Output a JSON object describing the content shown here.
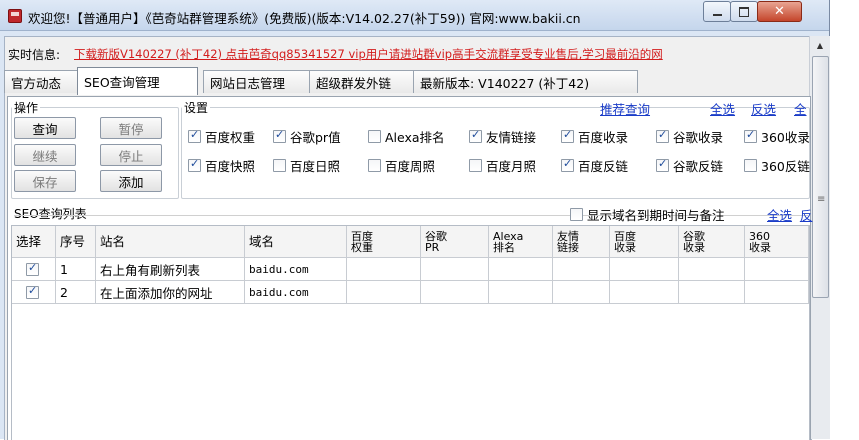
{
  "window": {
    "title": "欢迎您!【普通用户】《芭奇站群管理系统》(免费版)(版本:V14.02.27(补丁59)) 官网:www.bakii.cn",
    "buttons": {
      "minimize_icon": "minimize-icon",
      "maximize_icon": "maximize-icon",
      "close_icon": "close-icon"
    }
  },
  "marquee": {
    "label": "实时信息:",
    "text": "下载新版V140227 (补丁42) 点击芭奇qq85341527 vip用户请进站群vip高手交流群享受专业售后,学习最前沿的网"
  },
  "tabs": [
    {
      "label": "官方动态",
      "active": false
    },
    {
      "label": "SEO查询管理",
      "active": true
    },
    {
      "label": "网站日志管理",
      "active": false
    },
    {
      "label": "超级群发外链",
      "active": false
    },
    {
      "label": "最新版本: V140227 (补丁42)",
      "active": false
    }
  ],
  "operations": {
    "legend": "操作",
    "query": "查询",
    "pause": "暂停",
    "continue": "继续",
    "stop": "停止",
    "save": "保存",
    "add": "添加"
  },
  "settings": {
    "legend": "设置",
    "recommend_link": "推荐查询",
    "select_all": "全选",
    "invert": "反选",
    "all_truncated": "全",
    "row1": [
      {
        "label": "百度权重",
        "checked": true
      },
      {
        "label": "谷歌pr值",
        "checked": true
      },
      {
        "label": "Alexa排名",
        "checked": false
      },
      {
        "label": "友情链接",
        "checked": true
      },
      {
        "label": "百度收录",
        "checked": true
      },
      {
        "label": "谷歌收录",
        "checked": true
      },
      {
        "label": "360收录",
        "checked": true
      }
    ],
    "row2": [
      {
        "label": "百度快照",
        "checked": true
      },
      {
        "label": "百度日照",
        "checked": false
      },
      {
        "label": "百度周照",
        "checked": false
      },
      {
        "label": "百度月照",
        "checked": false
      },
      {
        "label": "百度反链",
        "checked": true
      },
      {
        "label": "谷歌反链",
        "checked": true
      },
      {
        "label": "360反链",
        "checked": false
      }
    ]
  },
  "list": {
    "title": "SEO查询列表",
    "show_expiry": {
      "label": "显示域名到期时间与备注",
      "checked": false
    },
    "select_all": "全选",
    "select_all_extra": "反",
    "columns": [
      "选择",
      "序号",
      "站名",
      "域名",
      "百度\n权重",
      "谷歌\nPR",
      "Alexa\n排名",
      "友情\n链接",
      "百度\n收录",
      "谷歌\n收录",
      "360\n收录"
    ],
    "rows": [
      {
        "checked": true,
        "index": "1",
        "name": "右上角有刷新列表",
        "domain": "baidu.com"
      },
      {
        "checked": true,
        "index": "2",
        "name": "在上面添加你的网址",
        "domain": "baidu.com"
      }
    ]
  }
}
